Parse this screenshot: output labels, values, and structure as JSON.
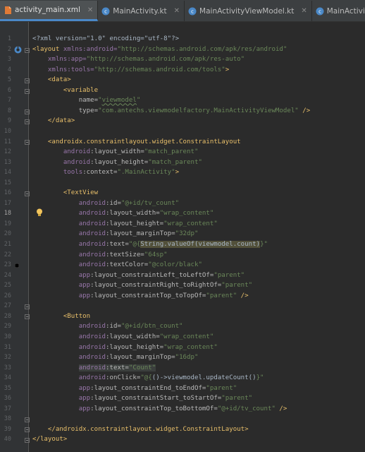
{
  "tabs": [
    {
      "label": "activity_main.xml",
      "icon": "xml-file-icon",
      "active": true
    },
    {
      "label": "MainActivity.kt",
      "icon": "kotlin-file-icon",
      "active": false
    },
    {
      "label": "MainActivityViewModel.kt",
      "icon": "kotlin-file-icon",
      "active": false
    },
    {
      "label": "MainActivityViewModelFactory.kt",
      "icon": "kotlin-file-icon",
      "active": false
    }
  ],
  "line_numbers": [
    "1",
    "2",
    "3",
    "4",
    "5",
    "6",
    "7",
    "8",
    "9",
    "10",
    "11",
    "12",
    "13",
    "14",
    "15",
    "16",
    "17",
    "18",
    "19",
    "20",
    "21",
    "22",
    "23",
    "24",
    "25",
    "26",
    "27",
    "28",
    "29",
    "30",
    "31",
    "32",
    "33",
    "34",
    "35",
    "36",
    "37",
    "38",
    "39",
    "40"
  ],
  "code": {
    "l1_decl": "<?xml version=\"1.0\" encoding=\"utf-8\"?>",
    "l2_tag": "<layout ",
    "l2_attr": "xmlns:android=",
    "l2_val": "\"http://schemas.android.com/apk/res/android\"",
    "l3_attr": "xmlns:app=",
    "l3_val": "\"http://schemas.android.com/apk/res-auto\"",
    "l4_attr": "xmlns:tools=",
    "l4_val": "\"http://schemas.android.com/tools\"",
    "l4_end": ">",
    "l5_tag": "<data>",
    "l6_tag": "<variable",
    "l7_attr": "name=",
    "l7_val_pre": "\"",
    "l7_val_mid": "viewmodel",
    "l7_val_post": "\"",
    "l8_attr": "type=",
    "l8_val": "\"com.antechs.viewmodelfactory.MainActivityViewModel\"",
    "l8_end": " />",
    "l9_tag": "</data>",
    "l11_tag": "<androidx.constraintlayout.widget.ConstraintLayout",
    "l12_ns": "android",
    "l12_attr": ":layout_width=",
    "l12_val": "\"match_parent\"",
    "l13_ns": "android",
    "l13_attr": ":layout_height=",
    "l13_val": "\"match_parent\"",
    "l14_ns": "tools",
    "l14_attr": ":context=",
    "l14_val": "\".MainActivity\"",
    "l14_end": ">",
    "l16_tag": "<TextView",
    "l17_ns": "android",
    "l17_attr": ":id=",
    "l17_val": "\"@+id/tv_count\"",
    "l18_ns": "android",
    "l18_attr": ":layout_width=",
    "l18_val": "\"wrap_content\"",
    "l19_ns": "android",
    "l19_attr": ":layout_height=",
    "l19_val": "\"wrap_content\"",
    "l20_ns": "android",
    "l20_attr": ":layout_marginTop=",
    "l20_val": "\"32dp\"",
    "l21_ns": "android",
    "l21_attr": ":text=",
    "l21_val_pre": "\"@{",
    "l21_expr": "String.valueOf(viewmodel.count)",
    "l21_val_post": "}\"",
    "l22_ns": "android",
    "l22_attr": ":textSize=",
    "l22_val": "\"64sp\"",
    "l23_ns": "android",
    "l23_attr": ":textColor=",
    "l23_val": "\"@color/black\"",
    "l24_ns": "app",
    "l24_attr": ":layout_constraintLeft_toLeftOf=",
    "l24_val": "\"parent\"",
    "l25_ns": "app",
    "l25_attr": ":layout_constraintRight_toRightOf=",
    "l25_val": "\"parent\"",
    "l26_ns": "app",
    "l26_attr": ":layout_constraintTop_toTopOf=",
    "l26_val": "\"parent\"",
    "l26_end": " />",
    "l28_tag": "<Button",
    "l29_ns": "android",
    "l29_attr": ":id=",
    "l29_val": "\"@+id/btn_count\"",
    "l30_ns": "android",
    "l30_attr": ":layout_width=",
    "l30_val": "\"wrap_content\"",
    "l31_ns": "android",
    "l31_attr": ":layout_height=",
    "l31_val": "\"wrap_content\"",
    "l32_ns": "android",
    "l32_attr": ":layout_marginTop=",
    "l32_val": "\"16dp\"",
    "l33_ns": "android",
    "l33_attr": ":text=",
    "l33_val": "\"Count\"",
    "l34_ns": "android",
    "l34_attr": ":onClick=",
    "l34_val_pre": "\"@{",
    "l34_expr": "()->viewmodel.updateCount()",
    "l34_val_post": "}\"",
    "l35_ns": "app",
    "l35_attr": ":layout_constraintEnd_toEndOf=",
    "l35_val": "\"parent\"",
    "l36_ns": "app",
    "l36_attr": ":layout_constraintStart_toStartOf=",
    "l36_val": "\"parent\"",
    "l37_ns": "app",
    "l37_attr": ":layout_constraintTop_toBottomOf=",
    "l37_val": "\"@+id/tv_count\"",
    "l37_end": " />",
    "l39_tag": "</androidx.constraintlayout.widget.ConstraintLayout>",
    "l40_tag": "</layout>"
  },
  "colors": {
    "background": "#2b2b2b",
    "gutter": "#313335",
    "tag": "#e8bf6a",
    "namespace": "#9876aa",
    "string": "#6a8759",
    "attribute": "#bababa",
    "highlight": "#52503a"
  }
}
